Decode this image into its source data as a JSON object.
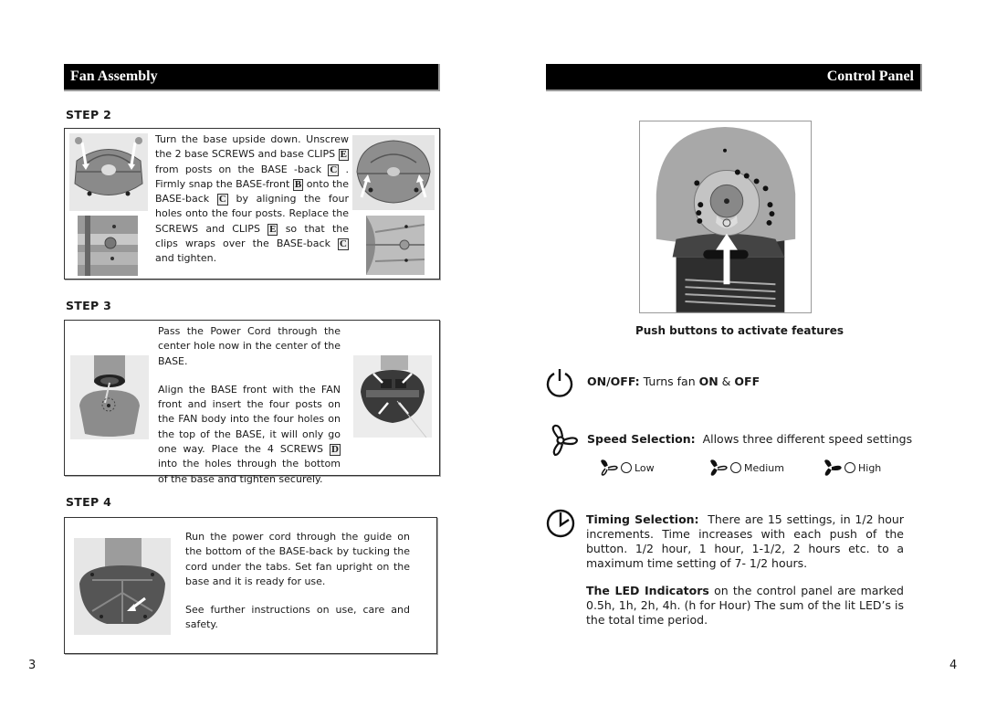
{
  "left_page": {
    "section_title": "Fan Assembly",
    "page_number": "3",
    "steps": [
      {
        "label": "STEP 2",
        "text": [
          [
            "Turn the base upside down. Unscrew the 2 base SCREWS and base CLIPS ",
            {
              "ref": "E"
            },
            " from posts on the BASE -back ",
            {
              "ref": "C"
            },
            " . Firmly snap the BASE-front ",
            {
              "ref": "B"
            },
            " onto the BASE-back ",
            {
              "ref": "C"
            },
            " by aligning the four holes onto the four posts. Replace the SCREWS and CLIPS ",
            {
              "ref": "E"
            },
            " so that the clips wraps over the BASE-back ",
            {
              "ref": "C"
            },
            " and tighten."
          ]
        ],
        "images": [
          "base-underside-arrows-photo",
          "base-post-closeup-photo",
          "base-assembled-arrows-photo",
          "base-clip-closeup-photo"
        ]
      },
      {
        "label": "STEP 3",
        "text": [
          [
            "Pass the Power Cord through the center hole now in the center of the BASE."
          ],
          [
            "Align the BASE front with the FAN front and insert the four posts on the FAN body into the four holes on the top of the BASE, it will only go one way. Place the 4 SCREWS ",
            {
              "ref": "D"
            },
            " into the holes through the bottom of the base and tighten securely."
          ]
        ],
        "images": [
          "cord-through-base-photo",
          "base-posts-arrows-photo"
        ]
      },
      {
        "label": "STEP 4",
        "text": [
          [
            "Run the power cord through the guide on the bottom of the BASE-back by tucking the cord under the tabs. Set fan upright on the base and it is ready for use."
          ],
          [
            "See further instructions on use, care and safety."
          ]
        ],
        "images": [
          "cord-guide-arrow-photo"
        ]
      }
    ]
  },
  "right_page": {
    "section_title": "Control Panel",
    "page_number": "4",
    "photo_caption": "Push buttons to activate features",
    "features": {
      "on_off": {
        "label": "ON/OFF:",
        "text_parts": [
          " Turns fan ",
          "ON",
          " & ",
          "OFF"
        ],
        "icon": "power-icon"
      },
      "speed": {
        "label": "Speed Selection:",
        "text": "Allows three different speed settings",
        "icon": "fan-icon",
        "options": [
          {
            "label": "Low",
            "level": 1
          },
          {
            "label": "Medium",
            "level": 2
          },
          {
            "label": "High",
            "level": 3
          }
        ]
      },
      "timing": {
        "label": "Timing Selection:",
        "text": "There are 15 settings, in 1/2 hour increments. Time increases with each push of the button.  1/2 hour, 1 hour, 1-1/2, 2 hours etc. to a maximum time setting of 7- 1/2 hours.",
        "icon": "timer-icon"
      },
      "led": {
        "label": "The LED Indicators",
        "text": " on the control panel are marked 0.5h, 1h, 2h, 4h.  (h for Hour) The sum of the lit LED’s is the total time period."
      }
    }
  }
}
